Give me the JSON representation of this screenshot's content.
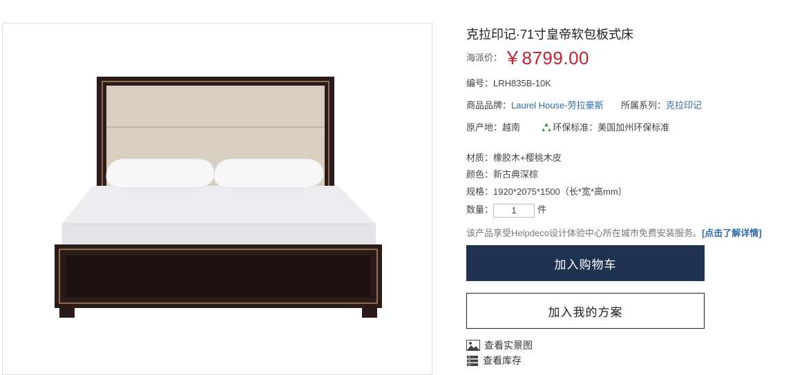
{
  "product": {
    "title": "克拉印记·71寸皇帝软包板式床",
    "price_label": "海派价：",
    "price": "￥8799.00",
    "code_label": "编号：",
    "code": "LRH835B-10K",
    "brand_label": "商品品牌：",
    "brand": "Laurel House-劳拉豪斯",
    "series_label": "所属系列：",
    "series": "克拉印记",
    "origin_label": "原产地：",
    "origin": "越南",
    "eco_label": "环保标准：",
    "eco": "美国加州环保标准",
    "material_label": "材质：",
    "material": "橡胶木+樱桃木皮",
    "color_label": "颜色：",
    "color": "新古典深棕",
    "spec_label": "规格：",
    "spec": "1920*2075*1500（长*宽*高mm）",
    "qty_label": "数量：",
    "qty": "1",
    "qty_unit": "件",
    "install_text": "该产品享受Helpdeco设计体验中心所在城市免费安装服务。",
    "install_link": "[点击了解详情]"
  },
  "actions": {
    "add_cart": "加入购物车",
    "add_plan": "加入我的方案",
    "view_photos": "查看实景图",
    "view_stock": "查看库存"
  },
  "colors": {
    "price": "#c81e2a",
    "link": "#2f6aa8",
    "cart_button": "#1f3252",
    "eco_icon": "#3a9a3a"
  }
}
